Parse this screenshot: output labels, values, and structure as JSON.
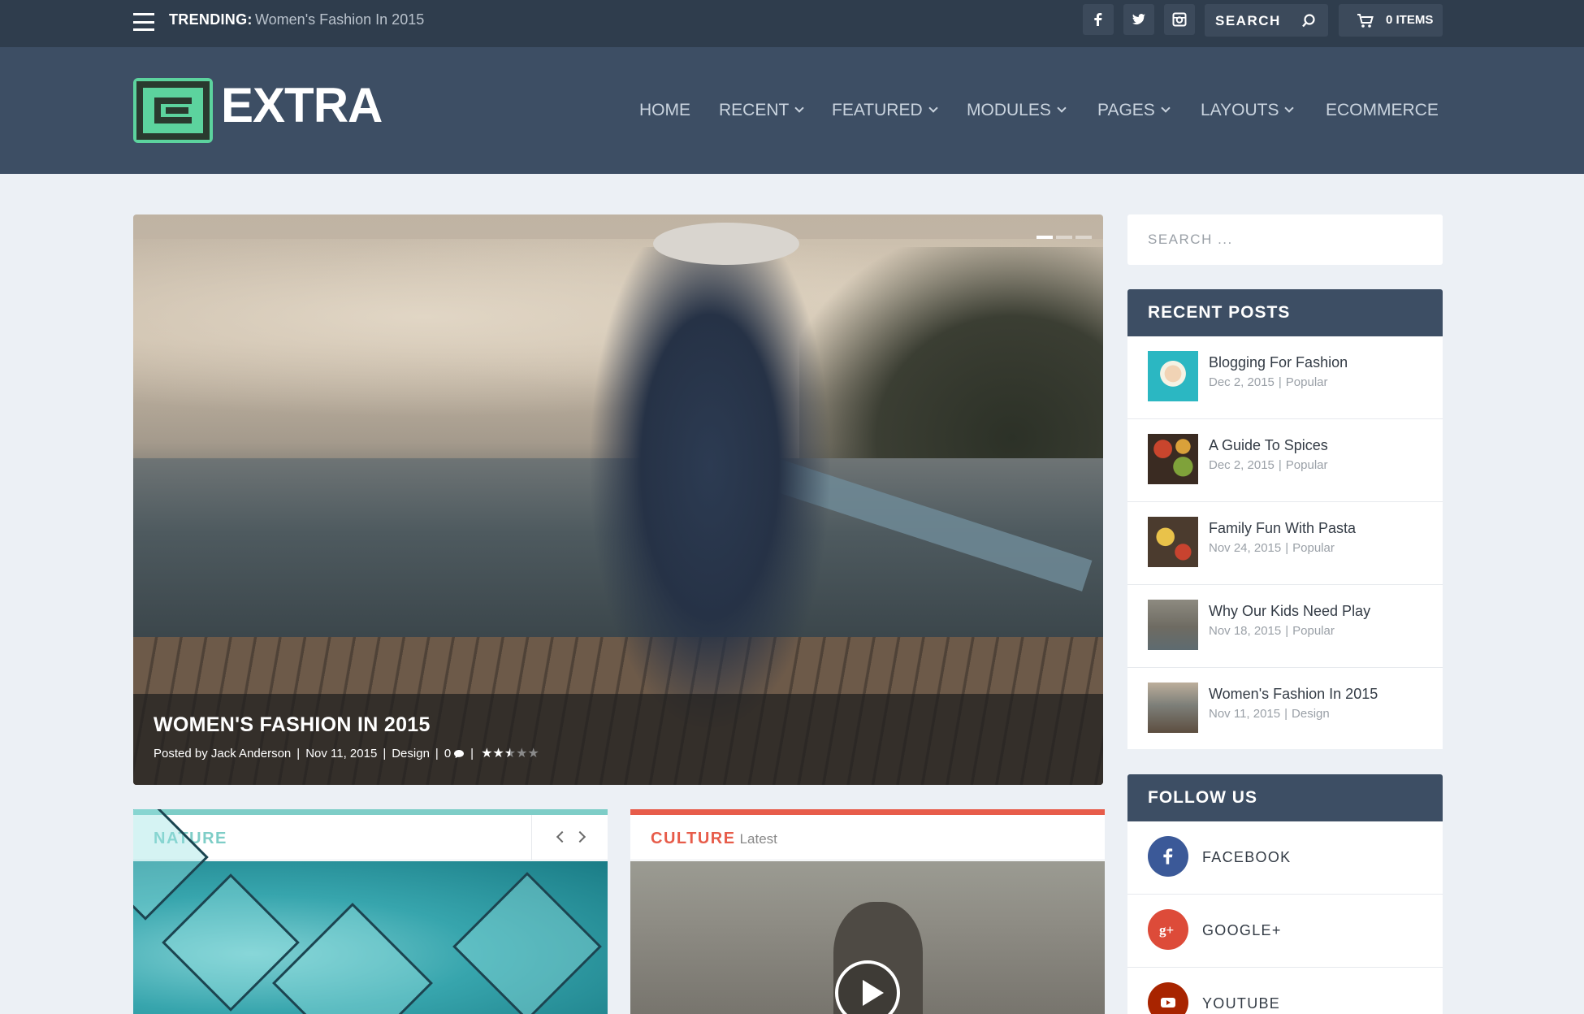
{
  "topbar": {
    "trending_label": "TRENDING:",
    "trending_title": "Women's Fashion In 2015",
    "search_label": "SEARCH",
    "cart_label": "0 ITEMS",
    "social_icons": [
      "facebook-icon",
      "twitter-icon",
      "instagram-icon"
    ]
  },
  "header": {
    "logo_text": "EXTRA",
    "logo_color": "#5cd39e",
    "nav": [
      {
        "label": "HOME",
        "dropdown": false
      },
      {
        "label": "RECENT",
        "dropdown": true
      },
      {
        "label": "FEATURED",
        "dropdown": true
      },
      {
        "label": "MODULES",
        "dropdown": true
      },
      {
        "label": "PAGES",
        "dropdown": true
      },
      {
        "label": "LAYOUTS",
        "dropdown": true
      },
      {
        "label": "ECOMMERCE",
        "dropdown": false
      }
    ]
  },
  "hero": {
    "title": "WOMEN'S FASHION IN 2015",
    "posted_by": "Posted by Jack Anderson",
    "date": "Nov 11, 2015",
    "category": "Design",
    "comments": "0",
    "rating": 2.5,
    "rating_max": 5
  },
  "cards": [
    {
      "title": "NATURE",
      "subtitle": "",
      "accent": "#7ecdc7"
    },
    {
      "title": "CULTURE",
      "subtitle": "Latest",
      "accent": "#e75c4a"
    }
  ],
  "sidebar": {
    "search_placeholder": "SEARCH ...",
    "recent_posts_title": "RECENT POSTS",
    "recent_posts": [
      {
        "title": "Blogging For Fashion",
        "date": "Dec 2, 2015",
        "category": "Popular"
      },
      {
        "title": "A Guide To Spices",
        "date": "Dec 2, 2015",
        "category": "Popular"
      },
      {
        "title": "Family Fun With Pasta",
        "date": "Nov 24, 2015",
        "category": "Popular"
      },
      {
        "title": "Why Our Kids Need Play",
        "date": "Nov 18, 2015",
        "category": "Popular"
      },
      {
        "title": "Women's Fashion In 2015",
        "date": "Nov 11, 2015",
        "category": "Design"
      }
    ],
    "follow_title": "FOLLOW US",
    "follow": [
      {
        "label": "FACEBOOK",
        "color": "#3b5998"
      },
      {
        "label": "GOOGLE+",
        "color": "#dd4b39"
      },
      {
        "label": "YOUTUBE",
        "color": "#a82400"
      }
    ]
  }
}
